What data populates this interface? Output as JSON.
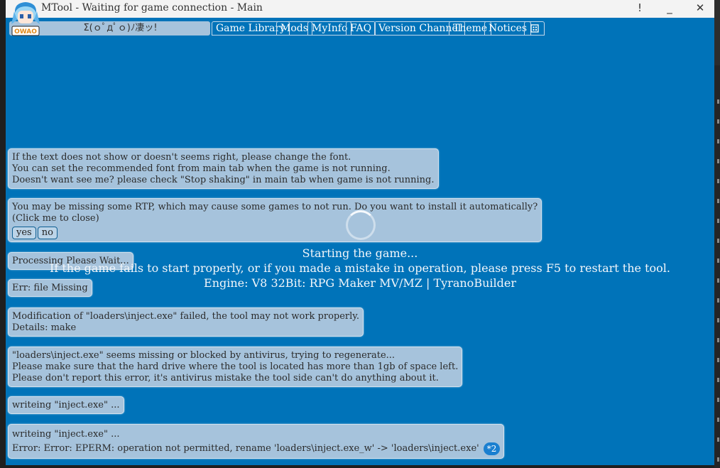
{
  "window": {
    "title": "MTool - Waiting for game connection - Main",
    "pin_label": "!",
    "minimize_label": "_",
    "close_label": "✕"
  },
  "avatar": {
    "badge_text": "OWAO"
  },
  "tabs": {
    "kaomoji": "Σ(ｏﾟдﾟｏ)ﾉ凄ッ!",
    "items": [
      "Game Library",
      "Mods",
      "MyInfo",
      "FAQ",
      "Version Channel",
      "Theme",
      "Notices"
    ],
    "extra_icon": "grid-icon"
  },
  "messages": {
    "font": [
      "If the text does not show or doesn't seems right, please change the font.",
      "You can set the recommended font from main tab when the game is not running.",
      "Doesn't want see me? please check \"Stop shaking\" in main tab when game is not running."
    ],
    "rtp": [
      "You may be missing some RTP, which may cause some games to not run. Do you want to install it automatically?",
      "(Click me to close)"
    ],
    "rtp_yes": "yes",
    "rtp_no": "no",
    "processing": "Processing Please Wait...",
    "err_missing": "Err: file Missing",
    "mod_fail": [
      "Modification of \"loaders\\inject.exe\" failed, the tool may not work properly.",
      "Details: make"
    ],
    "antivirus": [
      "\"loaders\\inject.exe\" seems missing or blocked by antivirus, trying to regenerate...",
      "Please make sure that the hard drive where the tool is located has more than 1gb of space left.",
      "Please don't report this error, it's antivirus mistake the tool side can't do anything about it."
    ],
    "writing1": "writeing \"inject.exe\" ...",
    "writing2": [
      "writeing \"inject.exe\" ...",
      "Error: Error: EPERM: operation not permitted, rename 'loaders\\inject.exe_w' -> 'loaders\\inject.exe'"
    ],
    "writing2_badge": "*2"
  },
  "status": {
    "starting": "Starting the game...",
    "hint": "If the game fails to start properly, or if you made a mistake in operation, please press F5 to restart the tool.",
    "engine": "Engine: V8 32Bit: RPG Maker MV/MZ | TyranoBuilder"
  },
  "colors": {
    "window_bg": "#0073b9",
    "message_bg": "#a6c3dc",
    "titlebar_bg": "#f3f3f3",
    "badge_bg": "#1a7fd0"
  }
}
